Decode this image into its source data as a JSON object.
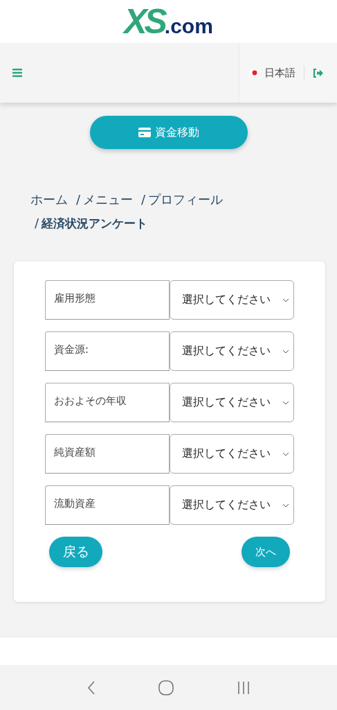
{
  "logo": {
    "mark": "XS",
    "suffix": ".com"
  },
  "header": {
    "language": "日本語"
  },
  "fund_button": {
    "label": "資金移動"
  },
  "breadcrumb_separator": "/",
  "breadcrumb": [
    {
      "label": "ホーム",
      "current": false
    },
    {
      "label": "メニュー",
      "current": false
    },
    {
      "label": "プロフィール",
      "current": false
    },
    {
      "label": "経済状況アンケート",
      "current": true
    }
  ],
  "form": {
    "fields": [
      {
        "label": "雇用形態",
        "value": "選択してください"
      },
      {
        "label": "資金源:",
        "value": "選択してください"
      },
      {
        "label": "おおよその年収",
        "value": "選択してください"
      },
      {
        "label": "純資産額",
        "value": "選択してください"
      },
      {
        "label": "流動資産",
        "value": "選択してください"
      }
    ],
    "back_button": "戻る",
    "next_button": "次へ"
  }
}
